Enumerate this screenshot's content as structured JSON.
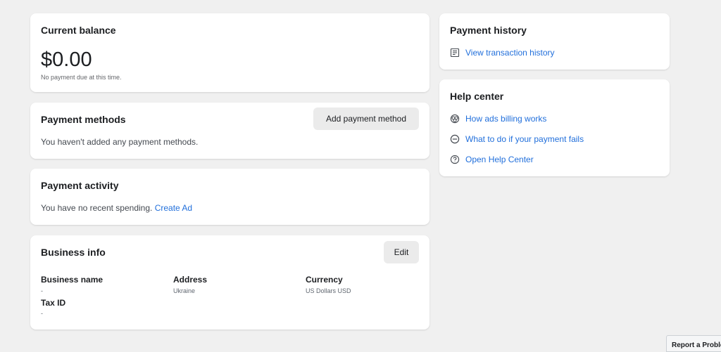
{
  "current_balance": {
    "title": "Current balance",
    "amount": "$0.00",
    "note": "No payment due at this time."
  },
  "payment_methods": {
    "title": "Payment methods",
    "add_button": "Add payment method",
    "message": "You haven't added any payment methods."
  },
  "payment_activity": {
    "title": "Payment activity",
    "message": "You have no recent spending.",
    "link": "Create Ad"
  },
  "business_info": {
    "title": "Business info",
    "edit_button": "Edit",
    "fields": {
      "business_name": {
        "label": "Business name",
        "value": "-"
      },
      "address": {
        "label": "Address",
        "value": "Ukraine"
      },
      "currency": {
        "label": "Currency",
        "value": "US Dollars USD"
      },
      "tax_id": {
        "label": "Tax ID",
        "value": "-"
      }
    }
  },
  "payment_history": {
    "title": "Payment history",
    "link": "View transaction history",
    "icon": "receipt-icon"
  },
  "help_center": {
    "title": "Help center",
    "links": [
      {
        "label": "How ads billing works",
        "icon": "coins-icon"
      },
      {
        "label": "What to do if your payment fails",
        "icon": "minus-circle-icon"
      },
      {
        "label": "Open Help Center",
        "icon": "question-circle-icon"
      }
    ]
  },
  "report_problem": {
    "label": "Report a Problem"
  },
  "colors": {
    "link": "#216fdb",
    "background": "#f0f0f0",
    "card": "#ffffff",
    "button": "#ebebeb"
  }
}
